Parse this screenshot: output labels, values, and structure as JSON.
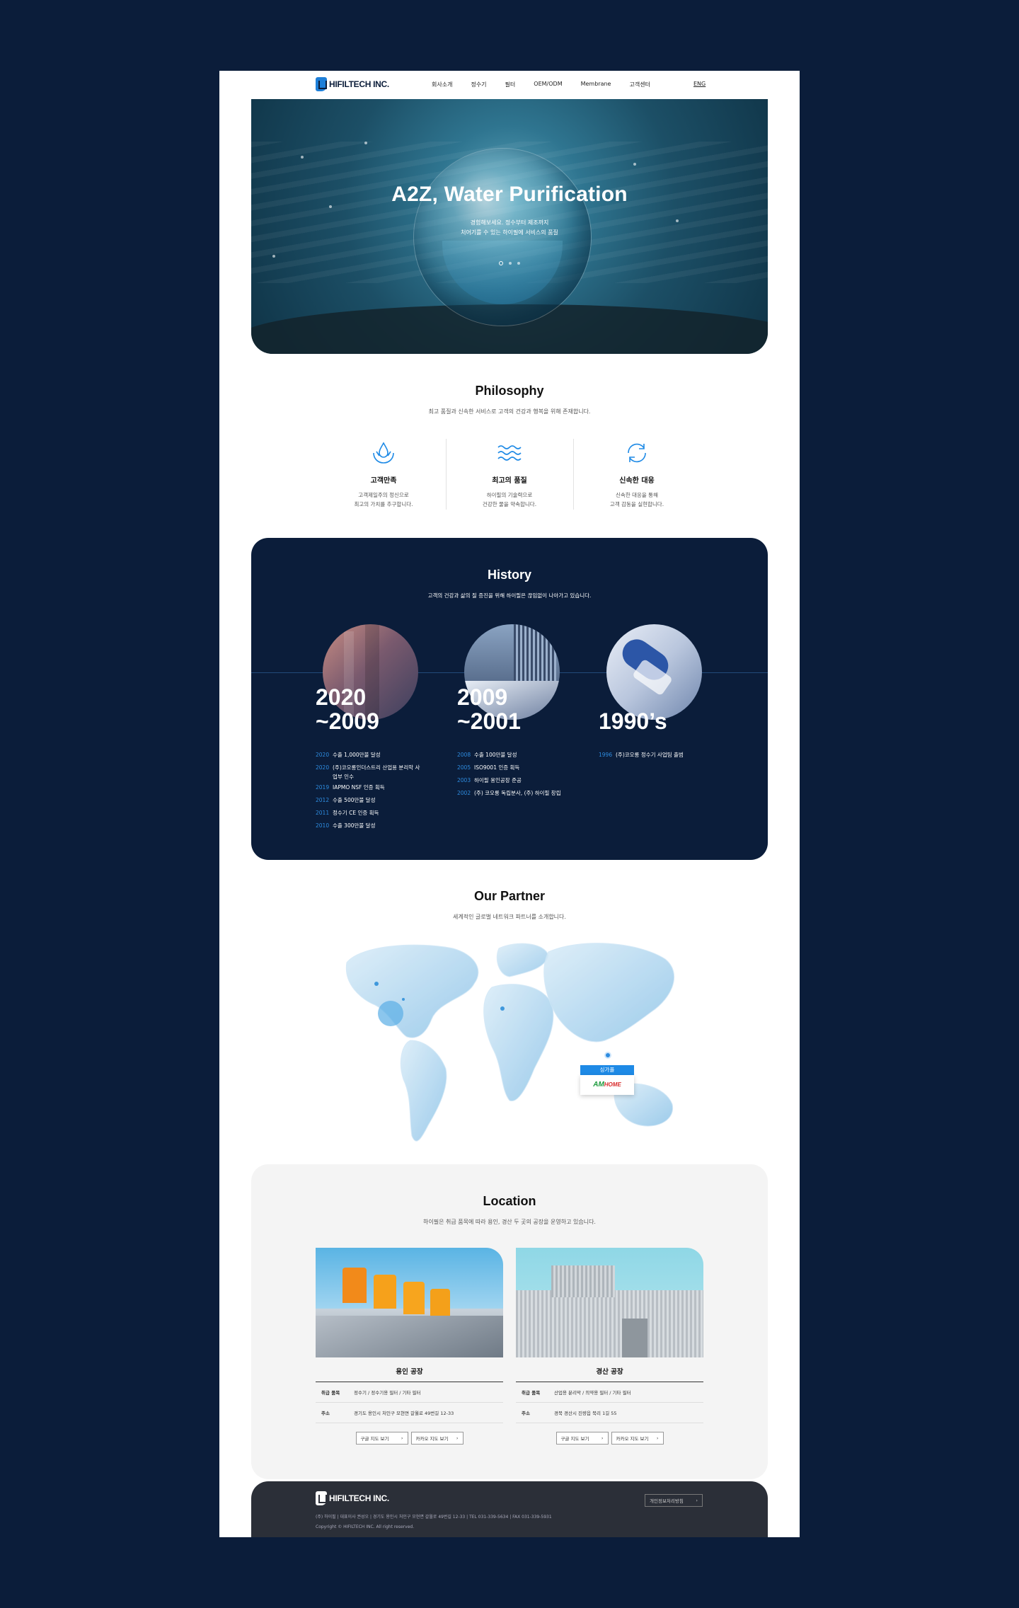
{
  "brand": {
    "logo_text": "HIFILTECH INC."
  },
  "nav": {
    "items": [
      "회사소개",
      "정수기",
      "필터",
      "OEM/ODM",
      "Membrane",
      "고객센터"
    ],
    "lang": "ENG"
  },
  "hero": {
    "title": "A2Z, Water Purification",
    "subtitle_line1": "경험해보세요. 정수부터 제조까지",
    "subtitle_line2": "처어기를 수 있는 하이필에 서비스의 품질",
    "slides": 3,
    "active_slide": 1
  },
  "philosophy": {
    "title": "Philosophy",
    "subtitle": "최고 품질과 신속한 서비스로 고객의 건강과 행복을 위해 존재합니다.",
    "items": [
      {
        "icon": "hand-water-icon",
        "title": "고객만족",
        "desc1": "고객제일주의 정신으로",
        "desc2": "최고의 가치를 추구합니다."
      },
      {
        "icon": "water-waves-icon",
        "title": "최고의 품질",
        "desc1": "하이필의 기술력으로",
        "desc2": "건강한 물을 약속합니다."
      },
      {
        "icon": "refresh-cycle-icon",
        "title": "신속한 대응",
        "desc1": "신속한 대응을 통해",
        "desc2": "고객 감동을 실현합니다."
      }
    ]
  },
  "history": {
    "title": "History",
    "subtitle": "고객의 건강과 삶의 질 증진을 위해 하이필은 끊임없이 나아가고 있습니다.",
    "eras": [
      {
        "era_line1": "2020",
        "era_line2": "~2009",
        "events": [
          {
            "year": "2020",
            "text": "수출 1,000만불 달성"
          },
          {
            "year": "2020",
            "text": "(주)코오롱인더스트리 산업용 분리막 사업부 인수"
          },
          {
            "year": "2019",
            "text": "IAPMO NSF 인증 획득"
          },
          {
            "year": "2012",
            "text": "수출 500만불 달성"
          },
          {
            "year": "2011",
            "text": "정수기 CE 인증 획득"
          },
          {
            "year": "2010",
            "text": "수출 300만불 달성"
          }
        ]
      },
      {
        "era_line1": "2009",
        "era_line2": "~2001",
        "events": [
          {
            "year": "2008",
            "text": "수출 100만불 달성"
          },
          {
            "year": "2005",
            "text": "ISO9001 인증 획득"
          },
          {
            "year": "2003",
            "text": "하이필 용인공장 준공"
          },
          {
            "year": "2002",
            "text": "(주) 코오롱 독립분사, (주) 하이필 창립"
          }
        ]
      },
      {
        "era_line1": "",
        "era_line2": "1990’s",
        "events": [
          {
            "year": "1996",
            "text": "(주)코오롱 정수기 사업팀 출범"
          }
        ]
      }
    ]
  },
  "partner": {
    "title": "Our Partner",
    "subtitle": "세계적인 글로벌 네트워크 파트너를 소개합니다.",
    "callout_country": "싱가폴",
    "callout_brand_a": "AM",
    "callout_brand_b": "HOME"
  },
  "location": {
    "title": "Location",
    "subtitle": "하이필은 취급 품목에 따라 용인, 경산 두 곳의 공장을 운영하고 있습니다.",
    "row_key_items": "취급 품목",
    "row_key_addr": "주소",
    "btn_google": "구글 지도 보기",
    "btn_kakao": "카카오 지도 보기",
    "plants": [
      {
        "name": "용인 공장",
        "items": "정수기 / 정수기용 필터 / 기타 필터",
        "addr": "경기도 용인시 처인구 모현면 갈월로 49번길 12-33"
      },
      {
        "name": "경산 공장",
        "items": "산업용 분리막 / 의약용 필터 / 기타 필터",
        "addr": "경북 경산시 진량읍 북리 1길 55"
      }
    ]
  },
  "footer": {
    "logo_text": "HIFILTECH INC.",
    "privacy_btn": "개인정보처리방침",
    "info": "(주) 하이필  |  대표이사 권성오  |  경기도 용인시 처인구 모현면 갈월로 49번길 12-33  |  TEL 031-339-5634  |  FAX 031-339-5931",
    "copyright": "Copyright © HIFILTECH INC. All right reserved."
  },
  "colors": {
    "navy": "#0b1d3a",
    "accent_blue": "#2e8ce0",
    "footer": "#2b2f38",
    "location_bg": "#f4f4f4"
  }
}
